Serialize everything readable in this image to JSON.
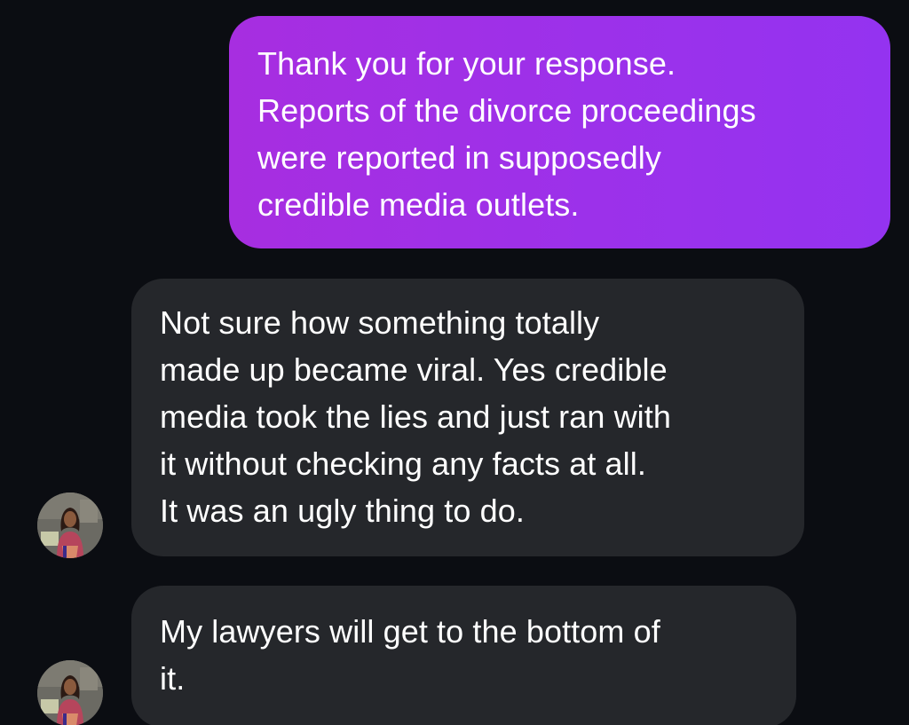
{
  "conversation": {
    "messages": [
      {
        "sender": "me",
        "text": "Thank you for your response.\nReports of the divorce proceedings\nwere reported in supposedly\ncredible media outlets."
      },
      {
        "sender": "contact",
        "text": "Not sure how something totally\nmade up became viral. Yes credible\nmedia took the lies and just ran with\nit without checking any facts at all.\nIt was an ugly thing to do."
      },
      {
        "sender": "contact",
        "text": "My lawyers will get to the bottom of\nit."
      }
    ]
  },
  "colors": {
    "background": "#0b0d12",
    "sent_bubble": "#9c31ea",
    "received_bubble": "#25272b",
    "text": "#ffffff"
  },
  "icons": {
    "avatar": "contact-profile-photo"
  }
}
